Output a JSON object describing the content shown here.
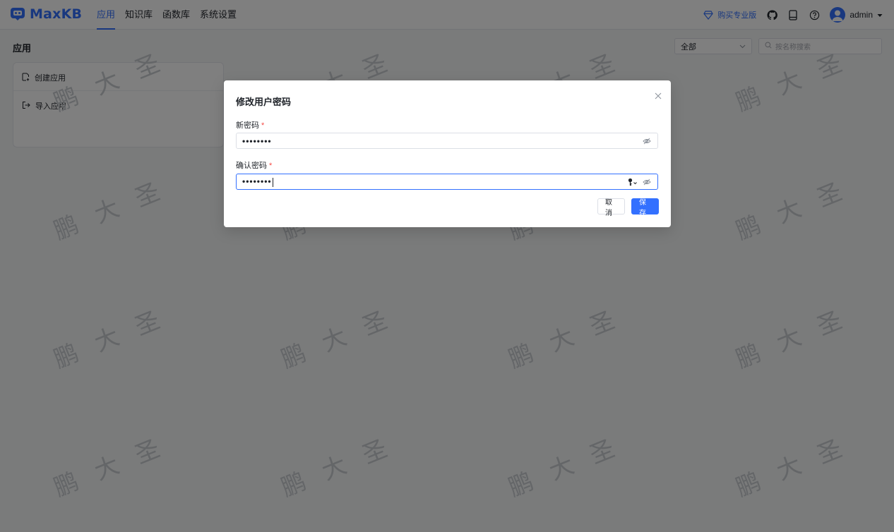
{
  "header": {
    "logo_text": "MaxKB",
    "nav": [
      "应用",
      "知识库",
      "函数库",
      "系统设置"
    ],
    "buy_label": "购买专业版",
    "username": "admin"
  },
  "main": {
    "page_title": "应用",
    "filter_value": "全部",
    "search_placeholder": "按名称搜索",
    "create_app_label": "创建应用",
    "import_app_label": "导入应用"
  },
  "watermark": {
    "text": "鹏大圣"
  },
  "dialog": {
    "title": "修改用户密码",
    "new_password_label": "新密码",
    "new_password_value": "••••••••",
    "confirm_password_label": "确认密码",
    "confirm_password_value": "••••••••",
    "required_mark": "*",
    "cancel_label": "取消",
    "save_label": "保存"
  },
  "colors": {
    "primary": "#3370ff",
    "required": "#f54a45",
    "overlay": "rgba(0,0,0,0.5)"
  }
}
